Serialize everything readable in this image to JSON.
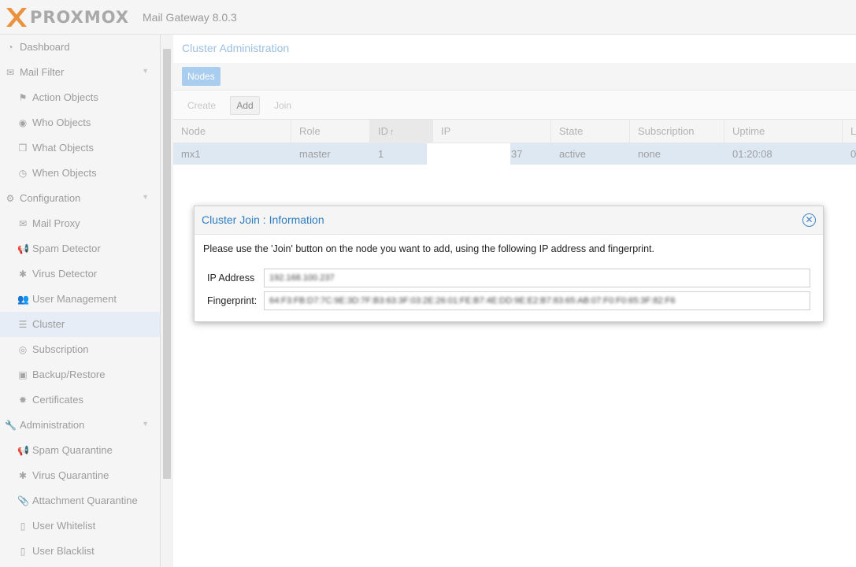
{
  "app": {
    "logo_text": "PROXMOX",
    "version": "Mail Gateway 8.0.3"
  },
  "sidebar": {
    "items": [
      {
        "label": "Dashboard",
        "icon": "dashboard-icon",
        "glyph": "◔",
        "level": 0
      },
      {
        "label": "Mail Filter",
        "icon": "envelope-icon",
        "glyph": "✉",
        "level": 0,
        "expandable": true
      },
      {
        "label": "Action Objects",
        "icon": "flag-icon",
        "glyph": "⚑",
        "level": 1
      },
      {
        "label": "Who Objects",
        "icon": "user-circle-icon",
        "glyph": "◉",
        "level": 1
      },
      {
        "label": "What Objects",
        "icon": "cube-icon",
        "glyph": "❒",
        "level": 1
      },
      {
        "label": "When Objects",
        "icon": "clock-icon",
        "glyph": "◷",
        "level": 1
      },
      {
        "label": "Configuration",
        "icon": "cogs-icon",
        "glyph": "⚙",
        "level": 0,
        "expandable": true
      },
      {
        "label": "Mail Proxy",
        "icon": "envelope-outline-icon",
        "glyph": "✉",
        "level": 1
      },
      {
        "label": "Spam Detector",
        "icon": "bullhorn-icon",
        "glyph": "📢",
        "level": 1
      },
      {
        "label": "Virus Detector",
        "icon": "bug-icon",
        "glyph": "✱",
        "level": 1
      },
      {
        "label": "User Management",
        "icon": "users-icon",
        "glyph": "👥",
        "level": 1
      },
      {
        "label": "Cluster",
        "icon": "server-icon",
        "glyph": "☰",
        "level": 1,
        "active": true
      },
      {
        "label": "Subscription",
        "icon": "support-icon",
        "glyph": "◎",
        "level": 1
      },
      {
        "label": "Backup/Restore",
        "icon": "floppy-icon",
        "glyph": "▣",
        "level": 1
      },
      {
        "label": "Certificates",
        "icon": "certificate-icon",
        "glyph": "✹",
        "level": 1
      },
      {
        "label": "Administration",
        "icon": "wrench-icon",
        "glyph": "🔧",
        "level": 0,
        "expandable": true
      },
      {
        "label": "Spam Quarantine",
        "icon": "bullhorn-icon",
        "glyph": "📢",
        "level": 1
      },
      {
        "label": "Virus Quarantine",
        "icon": "bug-icon",
        "glyph": "✱",
        "level": 1
      },
      {
        "label": "Attachment Quarantine",
        "icon": "paperclip-icon",
        "glyph": "📎",
        "level": 1
      },
      {
        "label": "User Whitelist",
        "icon": "file-icon",
        "glyph": "▯",
        "level": 1
      },
      {
        "label": "User Blacklist",
        "icon": "file-icon",
        "glyph": "▯",
        "level": 1
      }
    ]
  },
  "panel": {
    "title": "Cluster Administration",
    "tab_nodes": "Nodes"
  },
  "toolbar": {
    "create": "Create",
    "add": "Add",
    "join": "Join"
  },
  "grid": {
    "columns": [
      "Node",
      "Role",
      "ID",
      "IP",
      "State",
      "Subscription",
      "Uptime",
      "L"
    ],
    "sort_glyph": "↑",
    "rows": [
      {
        "node": "mx1",
        "role": "master",
        "id": "1",
        "ip_tail": "37",
        "state": "active",
        "subscription": "none",
        "uptime": "01:20:08",
        "load": "0"
      }
    ]
  },
  "dialog": {
    "title": "Cluster Join : Information",
    "close_glyph": "✕",
    "message": "Please use the 'Join' button on the node you want to add, using the following IP address and fingerprint.",
    "ip_label": "IP Address",
    "ip_value": "192.168.100.237",
    "fp_label": "Fingerprint:",
    "fp_value": "64:F3:FB:D7:7C:9E:3D:7F:B3:63:3F:03:2E:26:01:FE:B7:4E:DD:9E:E2:B7:83:65:AB:07:F0:F0:65:3F:82:F6"
  },
  "colors": {
    "accent": "#2f7dc1",
    "active_nav": "#e6edf6",
    "selected_row": "#dde8f3",
    "tab_active": "#a9cdee"
  }
}
